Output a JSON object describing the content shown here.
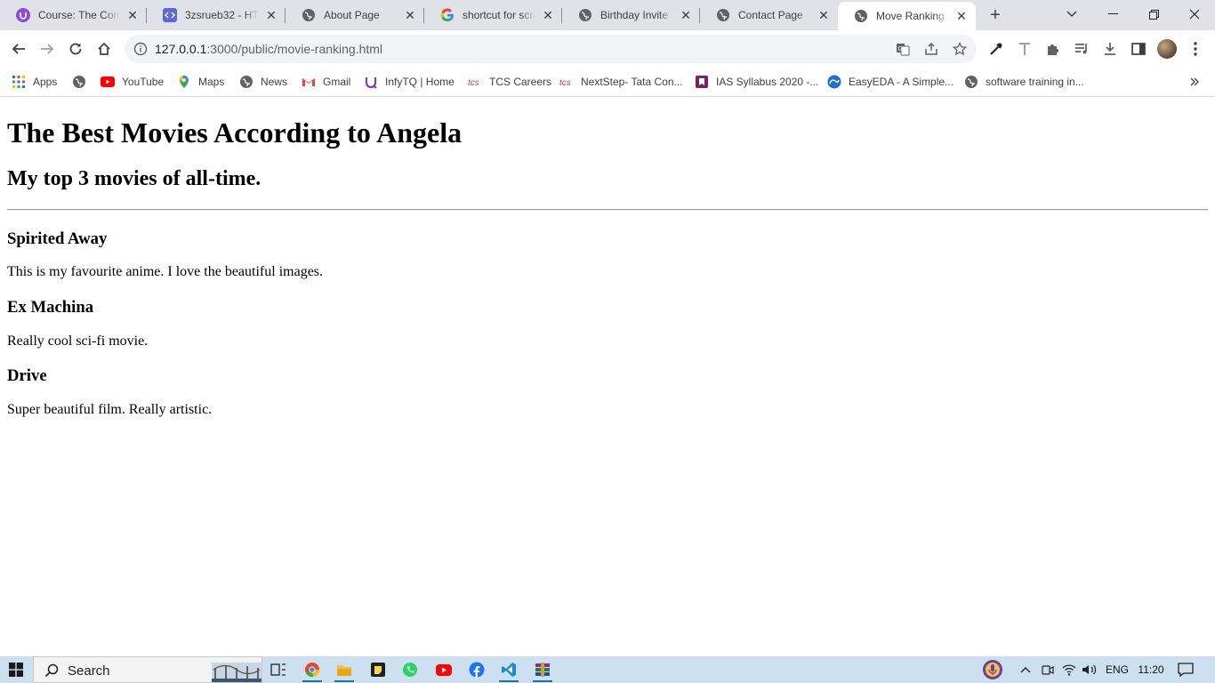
{
  "browser": {
    "tabs": [
      {
        "title": "Course: The Com",
        "favicon": "udemy-icon",
        "active": false
      },
      {
        "title": "3zsrueb32 - HTM",
        "favicon": "code-icon",
        "active": false
      },
      {
        "title": "About Page",
        "favicon": "globe-icon",
        "active": false
      },
      {
        "title": "shortcut for scre",
        "favicon": "google-icon",
        "active": false
      },
      {
        "title": "Birthday Invite",
        "favicon": "globe-icon",
        "active": false
      },
      {
        "title": "Contact Page",
        "favicon": "globe-icon",
        "active": false
      },
      {
        "title": "Move Ranking P",
        "favicon": "globe-icon",
        "active": true
      }
    ],
    "address": {
      "host": "127.0.0.1",
      "rest": ":3000/public/movie-ranking.html"
    },
    "bookmarks": [
      {
        "label": "Apps",
        "icon": "apps-grid-icon"
      },
      {
        "label": "",
        "icon": "globe-icon"
      },
      {
        "label": "YouTube",
        "icon": "youtube-icon"
      },
      {
        "label": "Maps",
        "icon": "maps-icon"
      },
      {
        "label": "News",
        "icon": "globe-icon"
      },
      {
        "label": "Gmail",
        "icon": "gmail-icon"
      },
      {
        "label": "InfyTQ | Home",
        "icon": "infytq-icon"
      },
      {
        "label": "TCS Careers",
        "icon": "tcs-icon"
      },
      {
        "label": "NextStep- Tata Con...",
        "icon": "tcs-icon"
      },
      {
        "label": "IAS Syllabus 2020 -...",
        "icon": "book-icon"
      },
      {
        "label": "EasyEDA - A Simple...",
        "icon": "easyeda-icon"
      },
      {
        "label": "software training in...",
        "icon": "globe-icon"
      }
    ]
  },
  "page": {
    "heading": "The Best Movies According to Angela",
    "subheading": "My top 3 movies of all-time.",
    "movies": [
      {
        "title": "Spirited Away",
        "description": "This is my favourite anime. I love the beautiful images."
      },
      {
        "title": "Ex Machina",
        "description": "Really cool sci-fi movie."
      },
      {
        "title": "Drive",
        "description": "Super beautiful film. Really artistic."
      }
    ]
  },
  "taskbar": {
    "search_label": "Search",
    "language": "ENG",
    "time": "11:20"
  },
  "colors": {
    "tabstrip": "#dfe3e8",
    "taskbar": "#cde0ef",
    "youtube": "#ff0000",
    "tcs": "#d6336c"
  }
}
